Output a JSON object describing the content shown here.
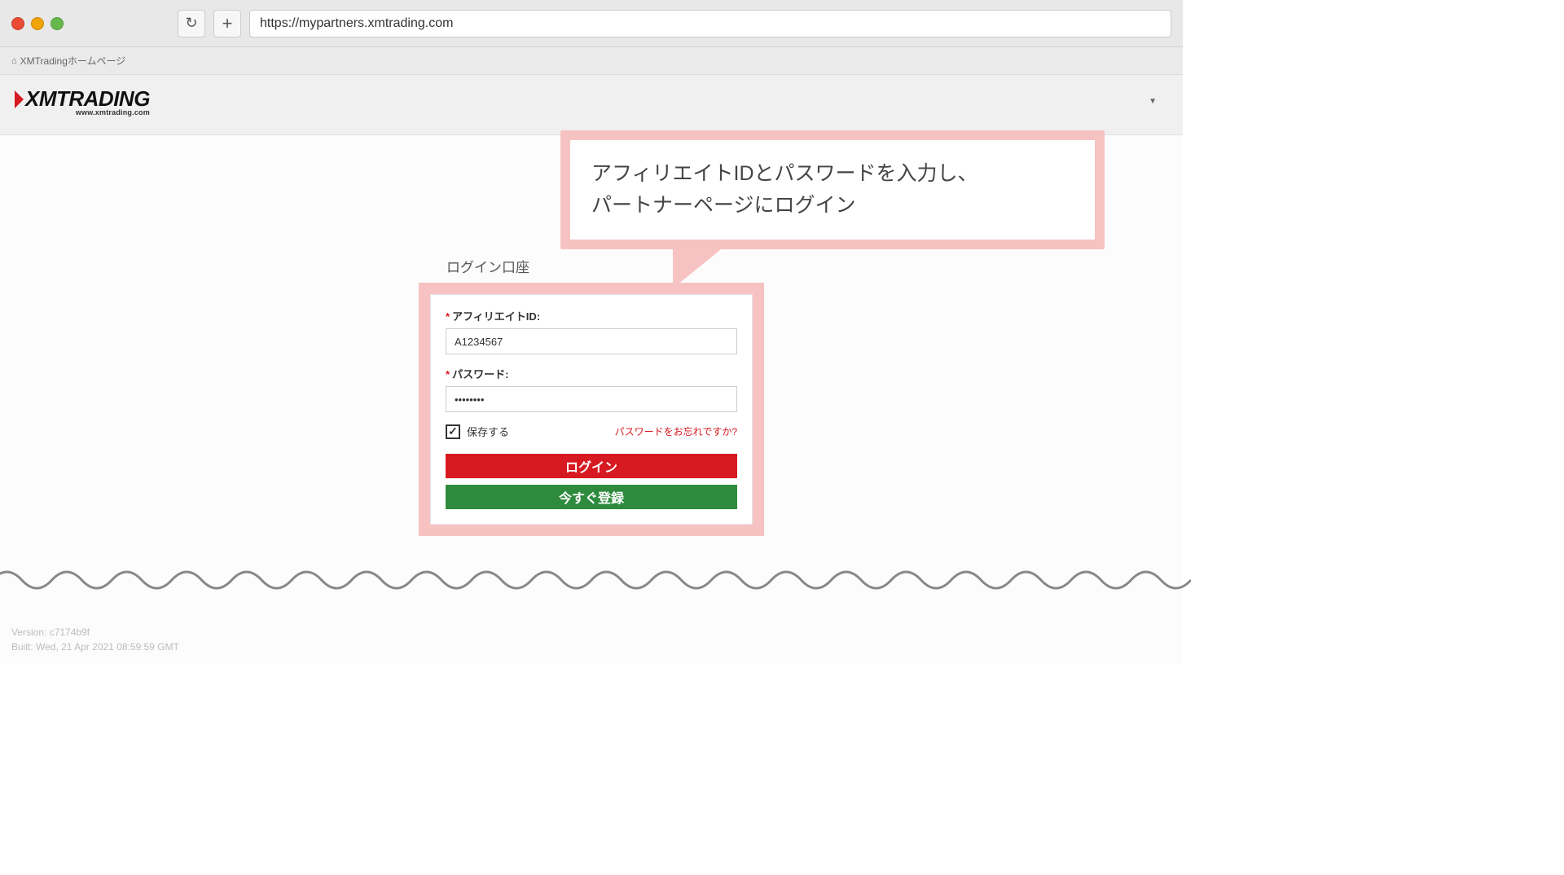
{
  "browser": {
    "url": "https://mypartners.xmtrading.com"
  },
  "breadcrumb": "XMTradingホームページ",
  "logo": {
    "main": "XMTRADING",
    "sub": "www.xmtrading.com"
  },
  "callout": {
    "line1": "アフィリエイトIDとパスワードを入力し、",
    "line2": "パートナーページにログイン"
  },
  "login": {
    "title": "ログイン口座",
    "affiliate_label": "アフィリエイトID:",
    "affiliate_value": "A1234567",
    "password_label": "パスワード:",
    "password_value": "••••••••",
    "remember_label": "保存する",
    "forgot_label": "パスワードをお忘れですか?",
    "login_button": "ログイン",
    "register_button": "今すぐ登録"
  },
  "footer": {
    "version": "Version: c7174b9f",
    "built": "Built: Wed, 21 Apr 2021 08:59:59 GMT"
  }
}
